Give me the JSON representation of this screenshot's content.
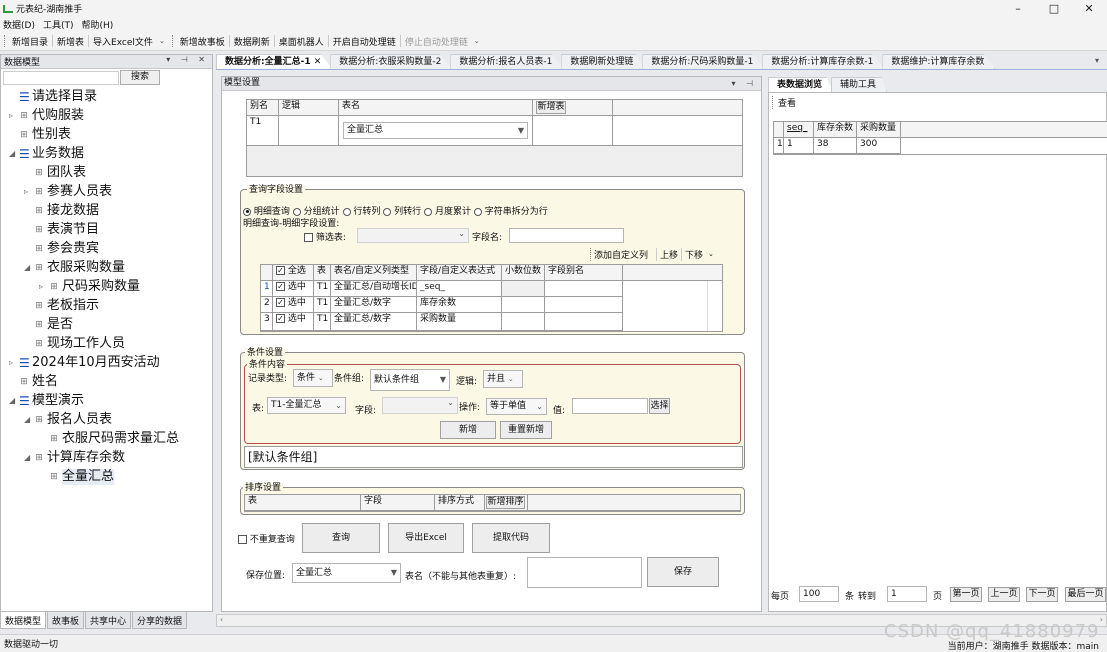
{
  "app": {
    "title": "元表纪-湖南推手",
    "win_min": "–",
    "win_max": "□",
    "win_close": "✕"
  },
  "menu": [
    "数据(D)",
    "工具(T)",
    "帮助(H)"
  ],
  "toolbar": {
    "new_catalog": "新增目录",
    "new_table": "新增表",
    "import_excel": "导入Excel文件",
    "new_story": "新增故事板",
    "data_refresh": "数据刷新",
    "desktop_robot": "桌面机器人",
    "start_auto": "开启自动处理链",
    "stop_auto": "停止自动处理链"
  },
  "left": {
    "header": "数据模型",
    "search_btn": "搜索",
    "tree": [
      "请选择目录",
      "代购服装",
      "性别表",
      "业务数据",
      "团队表",
      "参赛人员表",
      "接龙数据",
      "表演节目",
      "参会贵宾",
      "衣服采购数量",
      "尺码采购数量",
      "老板指示",
      "是否",
      "现场工作人员",
      "2024年10月西安活动",
      "姓名",
      "模型演示",
      "报名人员表",
      "衣服尺码需求量汇总",
      "计算库存余数",
      "全量汇总"
    ],
    "tabs": [
      "数据模型",
      "故事板",
      "共享中心",
      "分享的数据"
    ]
  },
  "doctabs": [
    "数据分析:全量汇总-1",
    "数据分析:衣服采购数量-2",
    "数据分析:报名人员表-1",
    "数据刷新处理链",
    "数据分析:尺码采购数量-1",
    "数据分析:计算库存余数-1",
    "数据维护:计算库存余数"
  ],
  "center": {
    "header": "模型设置",
    "table_grid": {
      "h_alias": "别名",
      "h_logic": "逻辑",
      "h_table": "表名",
      "add_btn": "新增表",
      "alias": "T1",
      "table": "全量汇总"
    },
    "query": {
      "title": "查询字段设置",
      "opts": [
        "明细查询",
        "分组统计",
        "行转列",
        "列转行",
        "月度累计",
        "字符串拆分为行"
      ],
      "sub": "明细查询-明细字段设置:",
      "filter_label": "筛选表:",
      "field_label": "字段名:",
      "add_col": "添加自定义列",
      "up": "上移",
      "down": "下移",
      "cols": [
        "全选",
        "表",
        "表名/自定义列类型",
        "字段/自定义表达式",
        "小数位数",
        "字段别名"
      ],
      "rows": [
        {
          "n": "1",
          "sel": "选中",
          "t": "T1",
          "tn": "全量汇总/自动增长ID",
          "f": "_seq_"
        },
        {
          "n": "2",
          "sel": "选中",
          "t": "T1",
          "tn": "全量汇总/数字",
          "f": "库存余数"
        },
        {
          "n": "3",
          "sel": "选中",
          "t": "T1",
          "tn": "全量汇总/数字",
          "f": "采购数量"
        }
      ]
    },
    "cond": {
      "title": "条件设置",
      "inner": "条件内容",
      "rec_type": "记录类型:",
      "rec_val": "条件",
      "grp_label": "条件组:",
      "grp_val": "默认条件组",
      "logic_label": "逻辑:",
      "logic_val": "并且",
      "tbl_label": "表:",
      "tbl_val": "T1-全量汇总",
      "fld_label": "字段:",
      "op_label": "操作:",
      "op_val": "等于单值",
      "val_label": "值:",
      "choose": "选择",
      "add": "新增",
      "reset": "重置新增",
      "default_grp": "[默认条件组]"
    },
    "sort": {
      "title": "排序设置",
      "h_table": "表",
      "h_field": "字段",
      "h_method": "排序方式",
      "add": "新增排序"
    },
    "actions": {
      "nodup": "不重复查询",
      "query": "查询",
      "export": "导出Excel",
      "extract": "提取代码"
    },
    "save": {
      "pos_label": "保存位置:",
      "pos_val": "全量汇总",
      "name_label": "表名（不能与其他表重复）:",
      "save_btn": "保存"
    }
  },
  "right": {
    "tabs": [
      "表数据浏览",
      "辅助工具"
    ],
    "view": "查看",
    "cols": [
      "seq_",
      "库存余数",
      "采购数量"
    ],
    "row": {
      "n": "1",
      "a": "1",
      "b": "38",
      "c": "300"
    },
    "pager": {
      "per": "每页",
      "per_val": "100",
      "unit": "条",
      "goto": "转到",
      "goto_val": "1",
      "page": "页",
      "first": "第一页",
      "prev": "上一页",
      "next": "下一页",
      "last": "最后一页"
    }
  },
  "status": {
    "left": "数据驱动一切",
    "right": "当前用户：湖南推手  数据版本：main",
    "watermark": "CSDN @qq_41880979"
  }
}
